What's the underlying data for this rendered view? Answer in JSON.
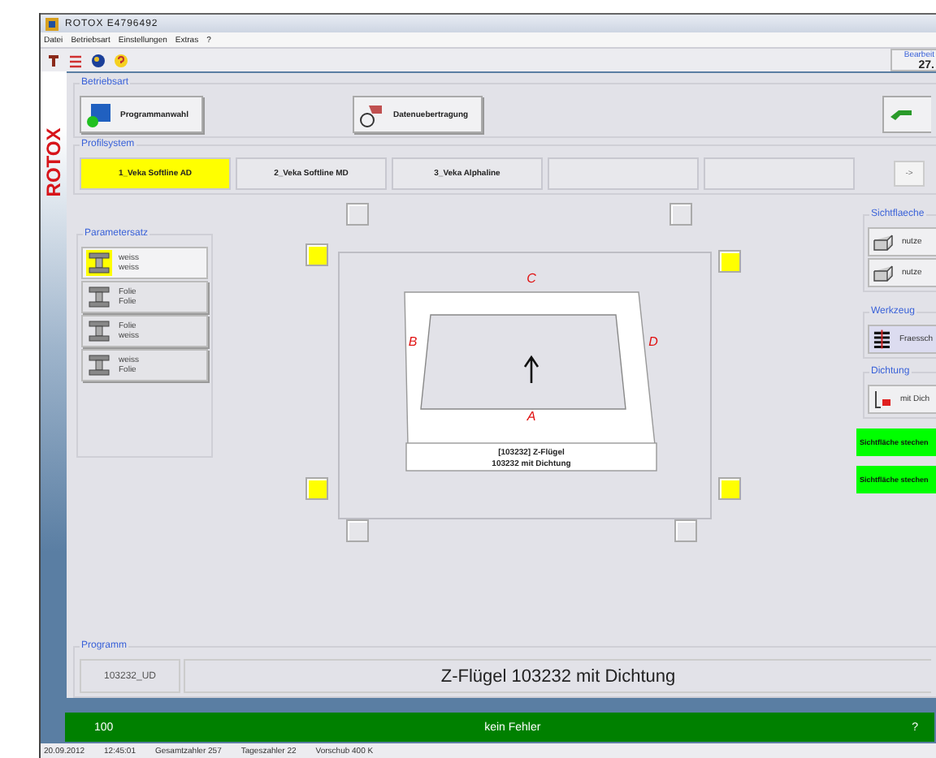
{
  "window": {
    "title": "ROTOX  E4796492"
  },
  "logo": "ROTOX",
  "menu": [
    "Datei",
    "Betriebsart",
    "Einstellungen",
    "Extras",
    "?"
  ],
  "counter": {
    "label": "Bearbeit",
    "value": "27."
  },
  "betriebsart": {
    "label": "Betriebsart",
    "buttons": [
      "Programmanwahl",
      "Datenuebertragung"
    ]
  },
  "profilsystem": {
    "label": "Profilsystem",
    "tabs": [
      {
        "label": "1_Veka Softline AD",
        "selected": true
      },
      {
        "label": "2_Veka Softline MD",
        "selected": false
      },
      {
        "label": "3_Veka Alphaline",
        "selected": false
      },
      {
        "selected": false
      },
      {
        "selected": false
      }
    ],
    "next": "->"
  },
  "parametersatz": {
    "label": "Parametersatz",
    "items": [
      {
        "top": "weiss",
        "bottom": "weiss",
        "selected": true
      },
      {
        "top": "Folie",
        "bottom": "Folie",
        "selected": false
      },
      {
        "top": "Folie",
        "bottom": "weiss",
        "selected": false
      },
      {
        "top": "weiss",
        "bottom": "Folie",
        "selected": false
      }
    ]
  },
  "preview": {
    "top": "C",
    "left": "B",
    "right": "D",
    "bottom": "A",
    "caption": [
      "[103232]  Z-Flügel",
      "103232 mit Dichtung"
    ]
  },
  "sichtflaeche": {
    "label": "Sichtflaeche",
    "buttons": [
      "nutze",
      "nutze"
    ]
  },
  "werkzeug": {
    "label": "Werkzeug",
    "value": "Fraessch"
  },
  "dichtung": {
    "label": "Dichtung",
    "value": "mit Dich"
  },
  "actions": [
    "Sichtfläche stechen",
    "Sichtfläche stechen"
  ],
  "programm": {
    "label": "Programm",
    "code": "103232_UD",
    "name": "Z-Flügel 103232 mit Dichtung"
  },
  "status": {
    "count": "100",
    "message": "kein Fehler",
    "help": "?"
  },
  "status_bar": [
    "20.09.2012",
    "12:45:01",
    "Gesamtzahler 257",
    "Tageszahler 22",
    "Vorschub 400 K"
  ]
}
